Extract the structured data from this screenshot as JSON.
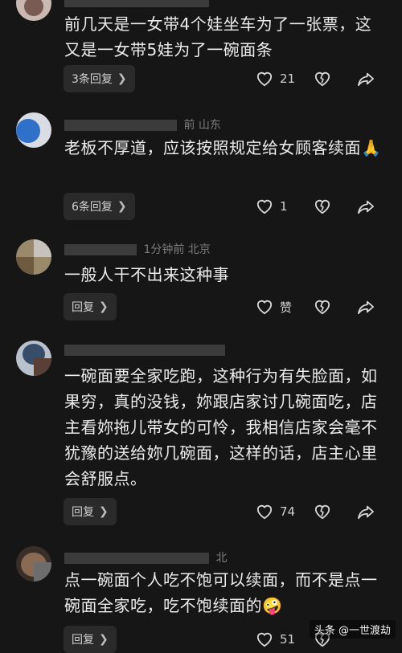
{
  "comments": [
    {
      "meta": "",
      "body": "前几天是一女带4个娃坐车为了一张票，这又是一女带5娃为了一碗面条",
      "reply_label": "3条回复",
      "likes": "21"
    },
    {
      "meta": "前 山东",
      "body": "老板不厚道，应该按照规定给女顾客续面🙏",
      "reply_label": "6条回复",
      "likes": "1"
    },
    {
      "meta": "1分钟前 北京",
      "body": "一般人干不出来这种事",
      "reply_label": "回复",
      "likes": "赞"
    },
    {
      "meta": "",
      "body": "一碗面要全家吃跑，这种行为有失脸面，如果穷，真的没钱，妳跟店家讨几碗面吃，店主看妳拖儿带女的可怜，我相信店家会毫不犹豫的送给妳几碗面，这样的话，店主心里会舒服点。",
      "reply_label": "回复",
      "likes": "74"
    },
    {
      "meta": "北",
      "body": "点一碗面个人吃不饱可以续面，而不是点一碗面全家吃，吃不饱续面的🤪",
      "reply_label": "回复",
      "likes": "51"
    }
  ],
  "watermark": "头条 @一世渡劫"
}
